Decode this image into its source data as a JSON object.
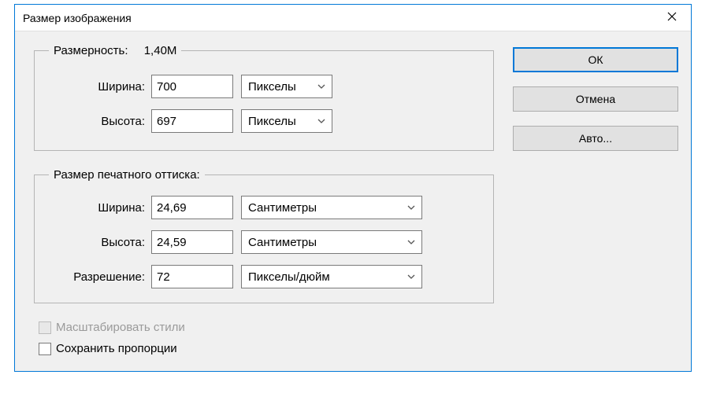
{
  "dialog": {
    "title": "Размер изображения"
  },
  "pixelDimensions": {
    "legend": "Размерность:",
    "sizeValue": "1,40M",
    "widthLabel": "Ширина:",
    "widthValue": "700",
    "widthUnit": "Пикселы",
    "heightLabel": "Высота:",
    "heightValue": "697",
    "heightUnit": "Пикселы"
  },
  "printSize": {
    "legend": "Размер печатного оттиска:",
    "widthLabel": "Ширина:",
    "widthValue": "24,69",
    "widthUnit": "Сантиметры",
    "heightLabel": "Высота:",
    "heightValue": "24,59",
    "heightUnit": "Сантиметры",
    "resolutionLabel": "Разрешение:",
    "resolutionValue": "72",
    "resolutionUnit": "Пикселы/дюйм"
  },
  "options": {
    "scaleStyles": "Масштабировать стили",
    "constrain": "Сохранить пропорции"
  },
  "buttons": {
    "ok": "ОК",
    "cancel": "Отмена",
    "auto": "Авто..."
  }
}
